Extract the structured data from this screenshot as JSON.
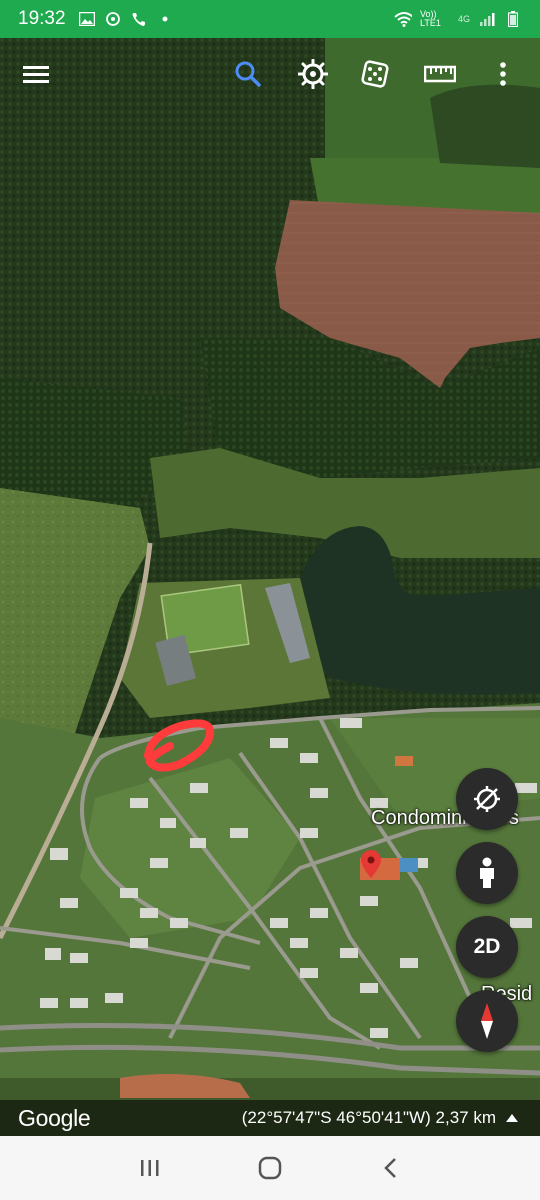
{
  "status_bar": {
    "time": "19:32",
    "network_label": "Vo)) LTE1",
    "network_gen": "4G",
    "icons": [
      "gallery-icon",
      "sync-icon",
      "phone-icon",
      "dot-icon",
      "wifi-icon",
      "signal-icon",
      "battery-icon"
    ]
  },
  "toolbar": {
    "icons": [
      "menu-icon",
      "search-icon",
      "voyager-icon",
      "random-dice-icon",
      "measure-ruler-icon",
      "more-icon"
    ]
  },
  "map": {
    "labels": {
      "condominio": "Condominio Res",
      "resid": "Resid"
    },
    "marker_icon": "location-pin-icon",
    "annotation": "red-circle-scribble"
  },
  "controls": {
    "two_d_label": "2D",
    "icons": [
      "tilt-off-icon",
      "pegman-icon",
      "compass-icon"
    ]
  },
  "info_bar": {
    "brand": "Google",
    "coordinates": "(22°57'47\"S 46°50'41\"W) 2,37 km"
  },
  "nav_bar": {
    "icons": [
      "recent-apps-icon",
      "home-icon",
      "back-icon"
    ]
  },
  "colors": {
    "status_green": "#1faa4f",
    "fab_bg": "#2b2b2b",
    "nav_bg": "#f6f6f6",
    "annotation_red": "#ff3b3b"
  }
}
